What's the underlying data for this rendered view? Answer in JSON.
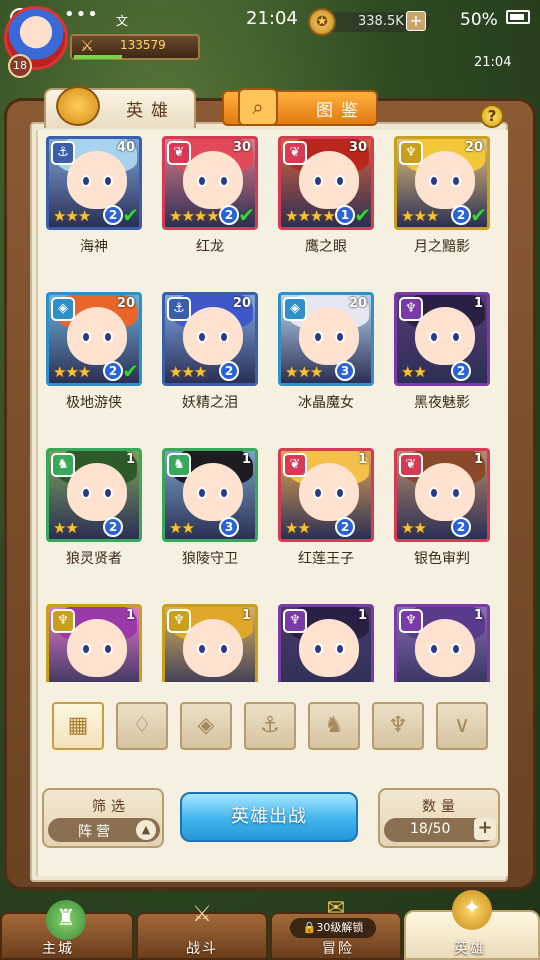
{
  "status_bar": {
    "time": "21:04",
    "battery": "50%",
    "notification": "文",
    "dots": "•••"
  },
  "hud": {
    "level": "18",
    "power": "133579",
    "gold": "338.5K",
    "add_symbol": "+",
    "clock": "21:04"
  },
  "tabs": [
    {
      "label": "英雄"
    },
    {
      "label": "图鉴"
    }
  ],
  "help": "?",
  "heroes": [
    {
      "name": "海神",
      "level": "40",
      "stars": "★★★",
      "number": "2",
      "class": "⚓",
      "checked": true,
      "colors": {
        "bg": "#7ea3d9",
        "hair": "#a8d3ee",
        "frame": "#3a5fa8"
      }
    },
    {
      "name": "红龙",
      "level": "30",
      "stars": "★★★★",
      "number": "2",
      "class": "❦",
      "checked": true,
      "colors": {
        "bg": "#e27a88",
        "hair": "#e24a5a",
        "frame": "#d63a55"
      }
    },
    {
      "name": "鹰之眼",
      "level": "30",
      "stars": "★★★★",
      "number": "1",
      "class": "❦",
      "checked": true,
      "colors": {
        "bg": "#d8603a",
        "hair": "#b8261c",
        "frame": "#d63a55"
      }
    },
    {
      "name": "月之黯影",
      "level": "20",
      "stars": "★★★",
      "number": "2",
      "class": "♆",
      "checked": true,
      "colors": {
        "bg": "#e6c27a",
        "hair": "#f4c73a",
        "frame": "#c8a01e"
      }
    },
    {
      "name": "极地游侠",
      "level": "20",
      "stars": "★★★",
      "number": "2",
      "class": "◈",
      "checked": true,
      "colors": {
        "bg": "#6fb0d8",
        "hair": "#e8662a",
        "frame": "#2f8fc8"
      }
    },
    {
      "name": "妖精之泪",
      "level": "20",
      "stars": "★★★",
      "number": "2",
      "class": "⚓",
      "checked": false,
      "colors": {
        "bg": "#7da9e8",
        "hair": "#3e58c8",
        "frame": "#3a5fa8"
      }
    },
    {
      "name": "冰晶魔女",
      "level": "20",
      "stars": "★★★",
      "number": "3",
      "class": "◈",
      "checked": false,
      "colors": {
        "bg": "#b9d7f0",
        "hair": "#e6e6f2",
        "frame": "#2f8fc8"
      }
    },
    {
      "name": "黑夜魅影",
      "level": "1",
      "stars": "★★",
      "number": "2",
      "class": "♆",
      "checked": false,
      "colors": {
        "bg": "#5a3a7a",
        "hair": "#2c1f44",
        "frame": "#7a3aa8"
      }
    },
    {
      "name": "狼灵贤者",
      "level": "1",
      "stars": "★★",
      "number": "2",
      "class": "♞",
      "checked": false,
      "colors": {
        "bg": "#7aa05a",
        "hair": "#2e5a2a",
        "frame": "#3aa85a"
      }
    },
    {
      "name": "狼陵守卫",
      "level": "1",
      "stars": "★★",
      "number": "3",
      "class": "♞",
      "checked": false,
      "colors": {
        "bg": "#7aa4c8",
        "hair": "#1c1c22",
        "frame": "#3aa85a"
      }
    },
    {
      "name": "红莲王子",
      "level": "1",
      "stars": "★★",
      "number": "2",
      "class": "❦",
      "checked": false,
      "colors": {
        "bg": "#e2a454",
        "hair": "#f4c04a",
        "frame": "#d63a55"
      }
    },
    {
      "name": "银色审判",
      "level": "1",
      "stars": "★★",
      "number": "2",
      "class": "❦",
      "checked": false,
      "colors": {
        "bg": "#b8896a",
        "hair": "#8a4a2a",
        "frame": "#d63a55"
      }
    },
    {
      "name": "",
      "level": "1",
      "stars": "",
      "number": "",
      "class": "♆",
      "checked": false,
      "colors": {
        "bg": "#e07ac8",
        "hair": "#9a3aa8",
        "frame": "#c8a01e"
      }
    },
    {
      "name": "",
      "level": "1",
      "stars": "",
      "number": "",
      "class": "♆",
      "checked": false,
      "colors": {
        "bg": "#d7b060",
        "hair": "#e0a82a",
        "frame": "#c8a01e"
      }
    },
    {
      "name": "",
      "level": "1",
      "stars": "",
      "number": "",
      "class": "♆",
      "checked": false,
      "colors": {
        "bg": "#4a3a6a",
        "hair": "#2a1f44",
        "frame": "#7a3aa8"
      }
    },
    {
      "name": "",
      "level": "1",
      "stars": "",
      "number": "",
      "class": "♆",
      "checked": false,
      "colors": {
        "bg": "#8a6ab8",
        "hair": "#5a3a8a",
        "frame": "#7a3aa8"
      }
    }
  ],
  "filters": [
    "▦",
    "♢",
    "◈",
    "⚓",
    "♞",
    "♆",
    "∨"
  ],
  "filter_box": {
    "title": "筛选",
    "value": "阵营",
    "caret": "▲"
  },
  "fight_button": "英雄出战",
  "count_box": {
    "title": "数量",
    "value": "18/50",
    "plus": "+"
  },
  "nav": [
    {
      "label": "主城",
      "icon": "castle-icon"
    },
    {
      "label": "战斗",
      "icon": "crossed-swords-icon"
    },
    {
      "label": "冒险",
      "icon": "map-icon"
    },
    {
      "label": "英雄",
      "icon": "hero-crest-icon"
    }
  ],
  "lock_badge": "30级解锁",
  "colors": {
    "accent": "#3fb4ee",
    "paper": "#f6f0e1",
    "panel": "#7a4c2a",
    "tab_active": "#e27a12"
  }
}
